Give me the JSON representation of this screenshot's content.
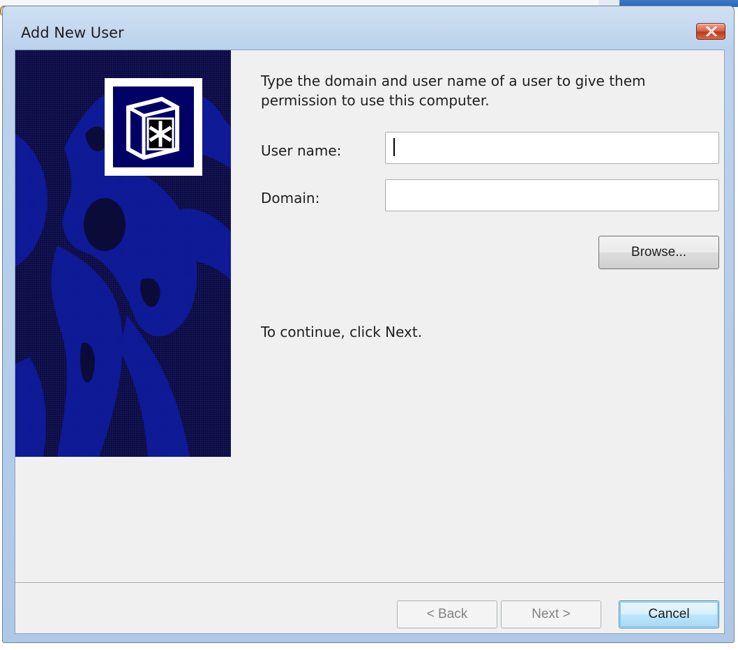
{
  "window": {
    "title": "Add New User"
  },
  "main": {
    "instruction": "Type the domain and user name of a user to give them permission to use this computer.",
    "user_name_label": "User name:",
    "user_name_value": "",
    "domain_label": "Domain:",
    "domain_value": "",
    "browse_label": "Browse...",
    "continue_text": "To continue, click Next."
  },
  "footer": {
    "back_label": "< Back",
    "next_label": "Next >",
    "cancel_label": "Cancel"
  },
  "colors": {
    "side_image_bg": "#0b0b3a",
    "figure_blue": "#0e1a9a",
    "close_button": "#c0391c"
  },
  "icons": [
    "close-icon",
    "asterisk-logo-icon"
  ]
}
